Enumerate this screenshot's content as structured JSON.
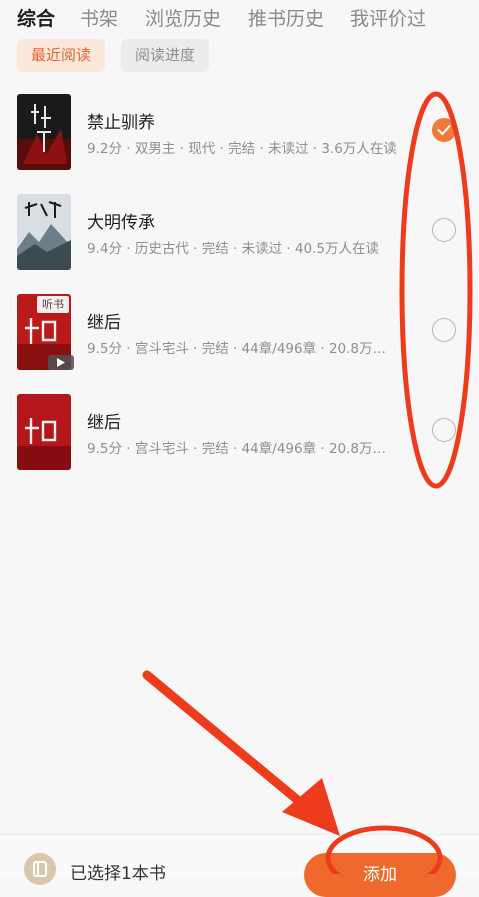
{
  "tabs": [
    "综合",
    "书架",
    "浏览历史",
    "推书历史",
    "我评价过"
  ],
  "active_tab": 0,
  "filters": {
    "recent": "最近阅读",
    "progress": "阅读进度"
  },
  "books": [
    {
      "title": "禁止驯养",
      "meta": "9.2分 · 双男主 · 现代 · 完结 · 未读过 · 3.6万人在读",
      "checked": true
    },
    {
      "title": "大明传承",
      "meta": "9.4分 · 历史古代 · 完结 · 未读过 · 40.5万人在读",
      "checked": false
    },
    {
      "title": "继后",
      "meta": "9.5分 · 宫斗宅斗 · 完结 · 44章/496章 · 20.8万…",
      "checked": false,
      "badge": "听书"
    },
    {
      "title": "继后",
      "meta": "9.5分 · 宫斗宅斗 · 完结 · 44章/496章 · 20.8万…",
      "checked": false
    }
  ],
  "bottom": {
    "selected_text": "已选择1本书",
    "add_label": "添加"
  },
  "colors": {
    "accent": "#f0692c",
    "annotation": "#ee3b1c"
  }
}
